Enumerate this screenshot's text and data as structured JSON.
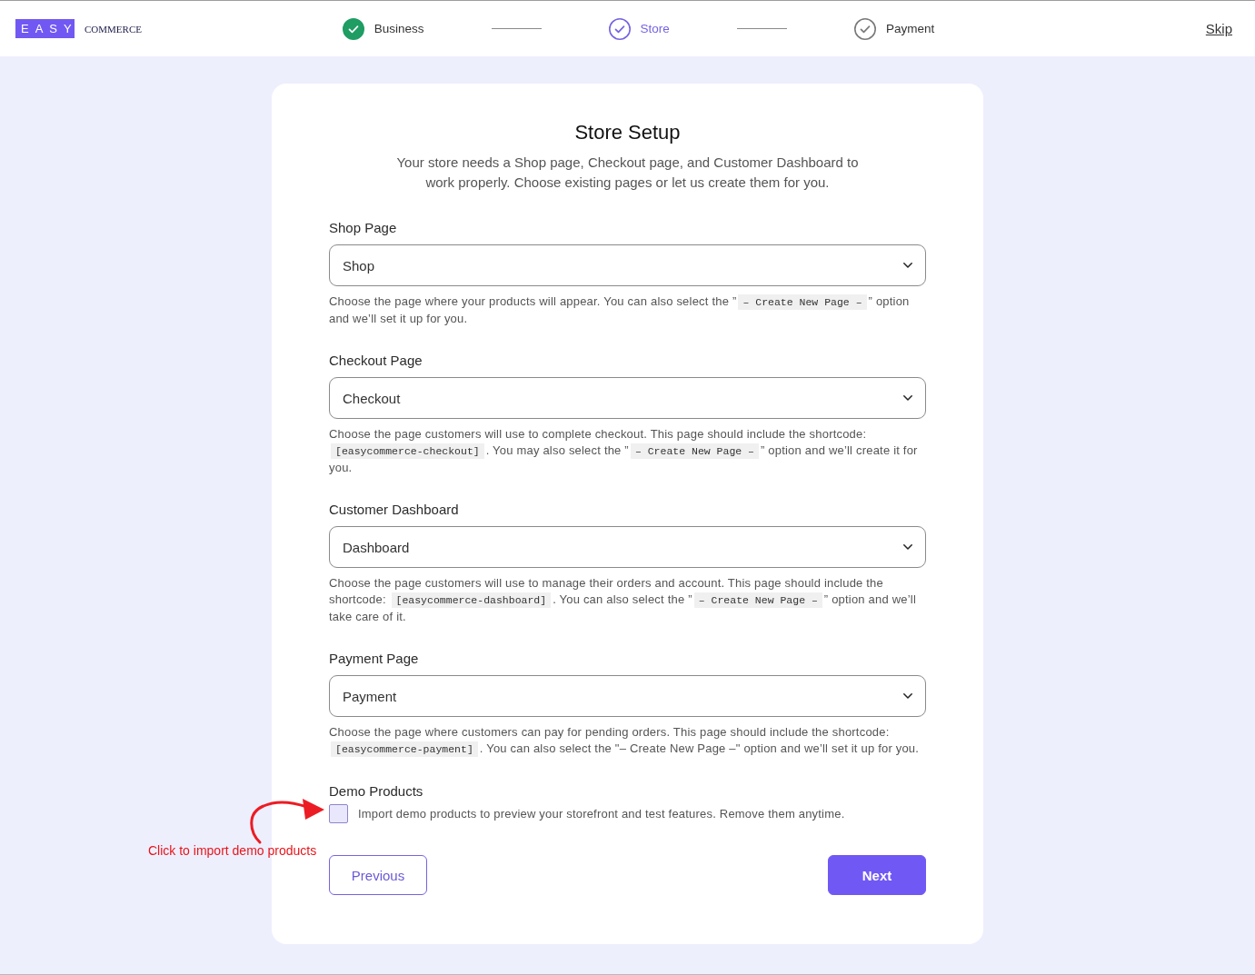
{
  "logo": {
    "mark": "EASY",
    "wordmark": "COMMERCE"
  },
  "steps": [
    {
      "label": "Business",
      "completed": true,
      "active": false
    },
    {
      "label": "Store",
      "completed": false,
      "active": true
    },
    {
      "label": "Payment",
      "completed": false,
      "active": false
    }
  ],
  "skip": "Skip",
  "card": {
    "title": "Store Setup",
    "subtitle": "Your store needs a Shop page, Checkout page, and Customer Dashboard to work properly. Choose existing pages or let us create them for you."
  },
  "fields": [
    {
      "label": "Shop Page",
      "value": "Shop",
      "help": [
        {
          "kind": "text",
          "text": "Choose the page where your products will appear. You can also select the ”"
        },
        {
          "kind": "code",
          "text": "– Create New Page –"
        },
        {
          "kind": "text",
          "text": "” option and we’ll set it up for you."
        }
      ]
    },
    {
      "label": "Checkout Page",
      "value": "Checkout",
      "help": [
        {
          "kind": "text",
          "text": "Choose the page customers will use to complete checkout. This page should include the shortcode: "
        },
        {
          "kind": "code",
          "text": "[easycommerce-checkout]"
        },
        {
          "kind": "text",
          "text": ". You may also select the ”"
        },
        {
          "kind": "code",
          "text": "– Create New Page –"
        },
        {
          "kind": "text",
          "text": "” option and we’ll create it for you."
        }
      ]
    },
    {
      "label": "Customer Dashboard",
      "value": "Dashboard",
      "help": [
        {
          "kind": "text",
          "text": "Choose the page customers will use to manage their orders and account. This page should include the shortcode: "
        },
        {
          "kind": "code",
          "text": "[easycommerce-dashboard]"
        },
        {
          "kind": "text",
          "text": ". You can also select the ”"
        },
        {
          "kind": "code",
          "text": "– Create New Page –"
        },
        {
          "kind": "text",
          "text": "” option and we’ll take care of it."
        }
      ]
    },
    {
      "label": "Payment Page",
      "value": "Payment",
      "help": [
        {
          "kind": "text",
          "text": "Choose the page where customers can pay for pending orders. This page should include the shortcode: "
        },
        {
          "kind": "code",
          "text": "[easycommerce-payment]"
        },
        {
          "kind": "text",
          "text": ". You can also select the \"– Create New Page –\" option and we’ll set it up for you."
        }
      ]
    }
  ],
  "demo": {
    "label": "Demo Products",
    "checkbox": {
      "checked": false,
      "text": "Import demo products to preview your storefront and test features. Remove them anytime."
    }
  },
  "buttons": [
    {
      "label": "Previous",
      "kind": "secondary"
    },
    {
      "label": "Next",
      "kind": "primary"
    }
  ],
  "annotation": {
    "text": "Click to import demo products"
  }
}
